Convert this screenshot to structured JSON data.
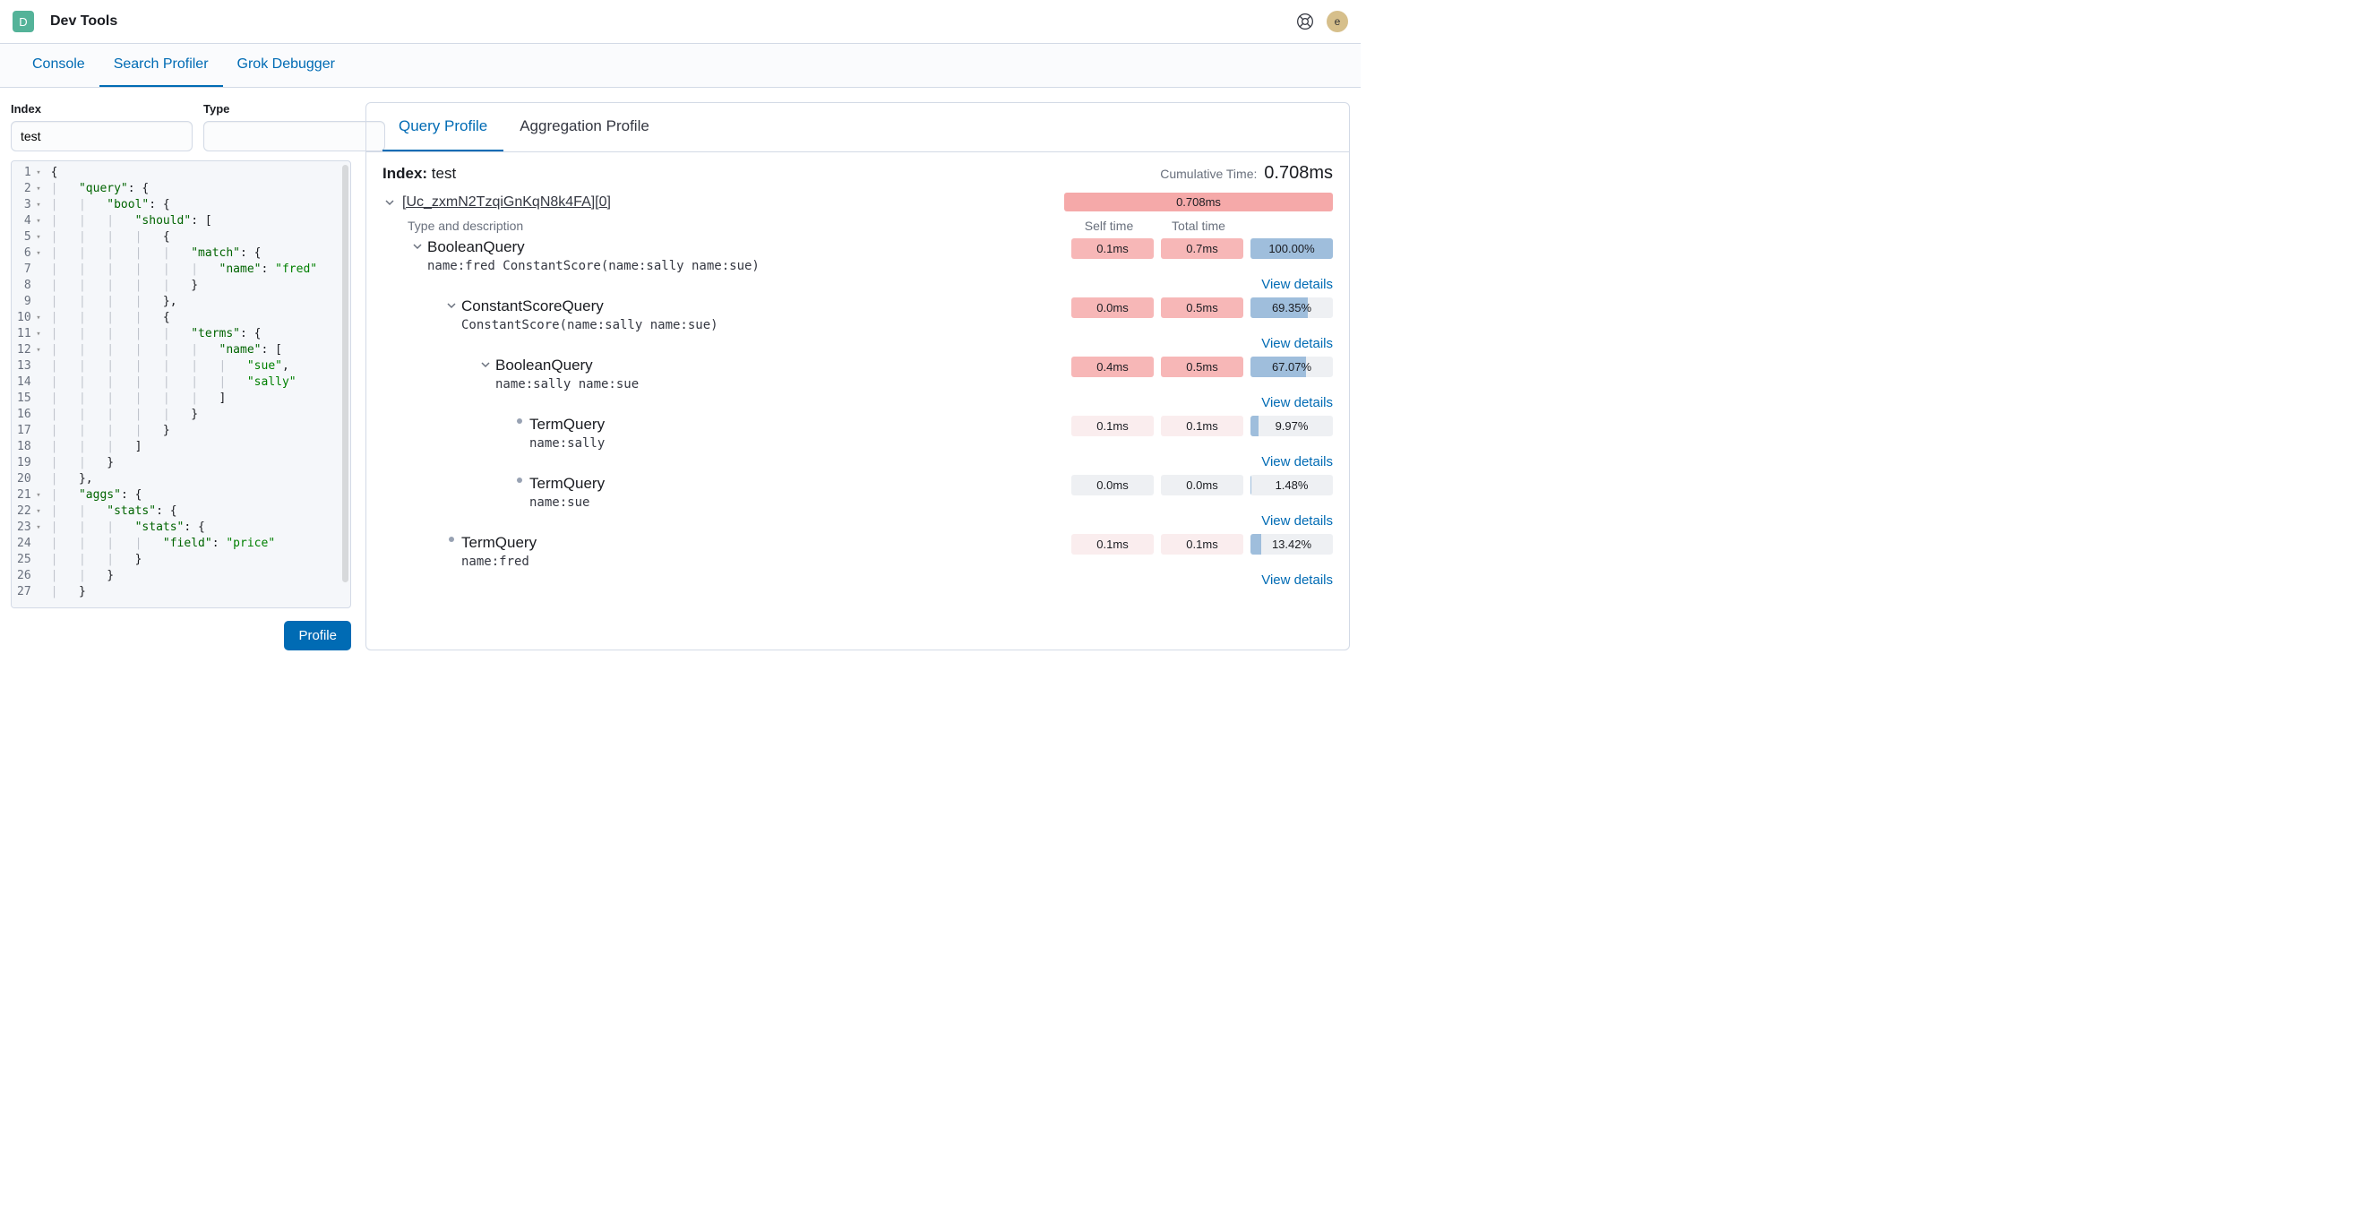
{
  "header": {
    "badge_letter": "D",
    "title": "Dev Tools",
    "avatar_letter": "e"
  },
  "tabs": {
    "console": "Console",
    "search_profiler": "Search Profiler",
    "grok": "Grok Debugger"
  },
  "form": {
    "index_label": "Index",
    "index_value": "test",
    "type_label": "Type",
    "type_value": "",
    "profile_button": "Profile"
  },
  "editor": {
    "lines": [
      {
        "n": 1,
        "fold": true,
        "html": "{"
      },
      {
        "n": 2,
        "fold": true,
        "html": "<span class='guide'>|</span>   <span class='tok-key'>\"query\"</span>: {"
      },
      {
        "n": 3,
        "fold": true,
        "html": "<span class='guide'>|</span>   <span class='guide'>|</span>   <span class='tok-key'>\"bool\"</span>: {"
      },
      {
        "n": 4,
        "fold": true,
        "html": "<span class='guide'>|</span>   <span class='guide'>|</span>   <span class='guide'>|</span>   <span class='tok-key'>\"should\"</span>: ["
      },
      {
        "n": 5,
        "fold": true,
        "html": "<span class='guide'>|</span>   <span class='guide'>|</span>   <span class='guide'>|</span>   <span class='guide'>|</span>   {"
      },
      {
        "n": 6,
        "fold": true,
        "html": "<span class='guide'>|</span>   <span class='guide'>|</span>   <span class='guide'>|</span>   <span class='guide'>|</span>   <span class='guide'>|</span>   <span class='tok-key'>\"match\"</span>: {"
      },
      {
        "n": 7,
        "fold": false,
        "html": "<span class='guide'>|</span>   <span class='guide'>|</span>   <span class='guide'>|</span>   <span class='guide'>|</span>   <span class='guide'>|</span>   <span class='guide'>|</span>   <span class='tok-key'>\"name\"</span>: <span class='tok-str'>\"fred\"</span>"
      },
      {
        "n": 8,
        "fold": false,
        "html": "<span class='guide'>|</span>   <span class='guide'>|</span>   <span class='guide'>|</span>   <span class='guide'>|</span>   <span class='guide'>|</span>   }"
      },
      {
        "n": 9,
        "fold": false,
        "html": "<span class='guide'>|</span>   <span class='guide'>|</span>   <span class='guide'>|</span>   <span class='guide'>|</span>   },"
      },
      {
        "n": 10,
        "fold": true,
        "html": "<span class='guide'>|</span>   <span class='guide'>|</span>   <span class='guide'>|</span>   <span class='guide'>|</span>   {"
      },
      {
        "n": 11,
        "fold": true,
        "html": "<span class='guide'>|</span>   <span class='guide'>|</span>   <span class='guide'>|</span>   <span class='guide'>|</span>   <span class='guide'>|</span>   <span class='tok-key'>\"terms\"</span>: {"
      },
      {
        "n": 12,
        "fold": true,
        "html": "<span class='guide'>|</span>   <span class='guide'>|</span>   <span class='guide'>|</span>   <span class='guide'>|</span>   <span class='guide'>|</span>   <span class='guide'>|</span>   <span class='tok-key'>\"name\"</span>: ["
      },
      {
        "n": 13,
        "fold": false,
        "html": "<span class='guide'>|</span>   <span class='guide'>|</span>   <span class='guide'>|</span>   <span class='guide'>|</span>   <span class='guide'>|</span>   <span class='guide'>|</span>   <span class='guide'>|</span>   <span class='tok-str'>\"sue\"</span>,"
      },
      {
        "n": 14,
        "fold": false,
        "html": "<span class='guide'>|</span>   <span class='guide'>|</span>   <span class='guide'>|</span>   <span class='guide'>|</span>   <span class='guide'>|</span>   <span class='guide'>|</span>   <span class='guide'>|</span>   <span class='tok-str'>\"sally\"</span>"
      },
      {
        "n": 15,
        "fold": false,
        "html": "<span class='guide'>|</span>   <span class='guide'>|</span>   <span class='guide'>|</span>   <span class='guide'>|</span>   <span class='guide'>|</span>   <span class='guide'>|</span>   ]"
      },
      {
        "n": 16,
        "fold": false,
        "html": "<span class='guide'>|</span>   <span class='guide'>|</span>   <span class='guide'>|</span>   <span class='guide'>|</span>   <span class='guide'>|</span>   }"
      },
      {
        "n": 17,
        "fold": false,
        "html": "<span class='guide'>|</span>   <span class='guide'>|</span>   <span class='guide'>|</span>   <span class='guide'>|</span>   }"
      },
      {
        "n": 18,
        "fold": false,
        "html": "<span class='guide'>|</span>   <span class='guide'>|</span>   <span class='guide'>|</span>   ]"
      },
      {
        "n": 19,
        "fold": false,
        "html": "<span class='guide'>|</span>   <span class='guide'>|</span>   }"
      },
      {
        "n": 20,
        "fold": false,
        "html": "<span class='guide'>|</span>   },"
      },
      {
        "n": 21,
        "fold": true,
        "html": "<span class='guide'>|</span>   <span class='tok-key'>\"aggs\"</span>: {"
      },
      {
        "n": 22,
        "fold": true,
        "html": "<span class='guide'>|</span>   <span class='guide'>|</span>   <span class='tok-key'>\"stats\"</span>: {"
      },
      {
        "n": 23,
        "fold": true,
        "html": "<span class='guide'>|</span>   <span class='guide'>|</span>   <span class='guide'>|</span>   <span class='tok-key'>\"stats\"</span>: {"
      },
      {
        "n": 24,
        "fold": false,
        "html": "<span class='guide'>|</span>   <span class='guide'>|</span>   <span class='guide'>|</span>   <span class='guide'>|</span>   <span class='tok-key'>\"field\"</span>: <span class='tok-str'>\"price\"</span>"
      },
      {
        "n": 25,
        "fold": false,
        "html": "<span class='guide'>|</span>   <span class='guide'>|</span>   <span class='guide'>|</span>   }"
      },
      {
        "n": 26,
        "fold": false,
        "html": "<span class='guide'>|</span>   <span class='guide'>|</span>   }"
      },
      {
        "n": 27,
        "fold": false,
        "html": "<span class='guide'>|</span>   }"
      }
    ]
  },
  "profile_tabs": {
    "query": "Query Profile",
    "aggregation": "Aggregation Profile"
  },
  "summary": {
    "index_label": "Index:",
    "index_value": "test",
    "cumulative_label": "Cumulative Time:",
    "cumulative_value": "0.708ms"
  },
  "shard": {
    "name": "[Uc_zxmN2TzqiGnKqN8k4FA][0]",
    "time": "0.708ms"
  },
  "headers": {
    "type_desc": "Type and description",
    "self_time": "Self time",
    "total_time": "Total time"
  },
  "view_details": "View details",
  "tree": [
    {
      "indent": 0,
      "toggle": "chev",
      "title": "BooleanQuery",
      "desc": "name:fred ConstantScore(name:sally name:sue)",
      "self": "0.1ms",
      "self_color": "m-pink",
      "total": "0.7ms",
      "total_color": "m-pink",
      "pct": "100.00%",
      "pct_fill": 100
    },
    {
      "indent": 1,
      "toggle": "chev",
      "title": "ConstantScoreQuery",
      "desc": "ConstantScore(name:sally name:sue)",
      "self": "0.0ms",
      "self_color": "m-pink",
      "total": "0.5ms",
      "total_color": "m-pink",
      "pct": "69.35%",
      "pct_fill": 69.35
    },
    {
      "indent": 2,
      "toggle": "chev",
      "title": "BooleanQuery",
      "desc": "name:sally name:sue",
      "self": "0.4ms",
      "self_color": "m-pink",
      "total": "0.5ms",
      "total_color": "m-pink",
      "pct": "67.07%",
      "pct_fill": 67.07
    },
    {
      "indent": 3,
      "toggle": "bullet",
      "title": "TermQuery",
      "desc": "name:sally",
      "self": "0.1ms",
      "self_color": "m-pale",
      "total": "0.1ms",
      "total_color": "m-pale",
      "pct": "9.97%",
      "pct_fill": 9.97
    },
    {
      "indent": 3,
      "toggle": "bullet",
      "title": "TermQuery",
      "desc": "name:sue",
      "self": "0.0ms",
      "self_color": "m-grey",
      "total": "0.0ms",
      "total_color": "m-grey",
      "pct": "1.48%",
      "pct_fill": 1.48
    },
    {
      "indent": 1,
      "toggle": "bullet",
      "title": "TermQuery",
      "desc": "name:fred",
      "self": "0.1ms",
      "self_color": "m-pale",
      "total": "0.1ms",
      "total_color": "m-pale",
      "pct": "13.42%",
      "pct_fill": 13.42
    }
  ]
}
